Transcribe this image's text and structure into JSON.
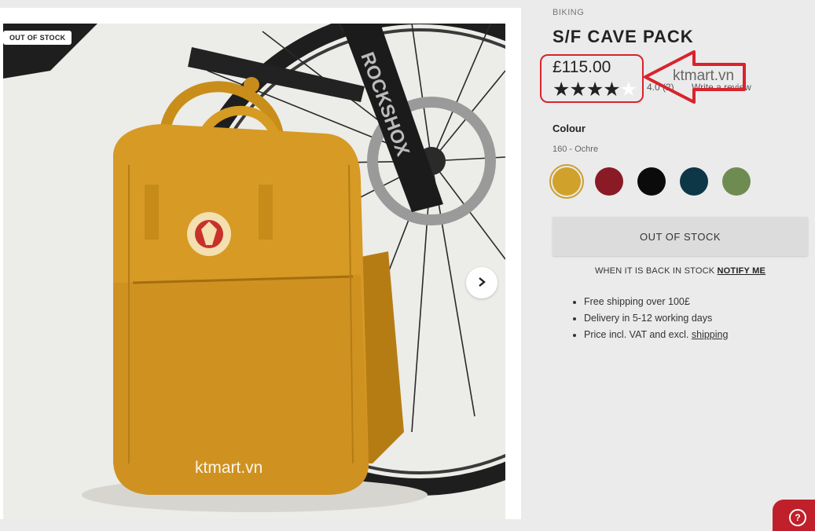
{
  "gallery": {
    "badge": "OUT OF STOCK",
    "watermark": "ktmart.vn",
    "next_icon": "chevron-right-icon"
  },
  "product": {
    "category": "BIKING",
    "title": "S/F CAVE PACK",
    "price": "£115.00",
    "rating": 4.0,
    "stars_filled": "★★★★",
    "stars_empty": "★",
    "rating_text": "4.0 (2)",
    "write_review": "Write a review",
    "watermark": "ktmart.vn"
  },
  "colour": {
    "label": "Colour",
    "value": "160 - Ochre",
    "swatches": [
      {
        "name": "Ochre",
        "color": "#d0a22b",
        "selected": true
      },
      {
        "name": "Red",
        "color": "#8a1a26",
        "selected": false
      },
      {
        "name": "Black",
        "color": "#0b0b0b",
        "selected": false
      },
      {
        "name": "Navy",
        "color": "#0d3647",
        "selected": false
      },
      {
        "name": "Green",
        "color": "#6e8c52",
        "selected": false
      }
    ]
  },
  "stock": {
    "button_label": "OUT OF STOCK",
    "notify_text": "WHEN IT IS BACK IN STOCK",
    "notify_link": "NOTIFY ME"
  },
  "benefits": {
    "item1": "Free shipping over 100£",
    "item2": "Delivery in 5-12 working days",
    "item3_text": "Price incl. VAT and excl.",
    "item3_link": "shipping"
  },
  "colors": {
    "highlight": "#d9232d",
    "help": "#c0202a"
  }
}
